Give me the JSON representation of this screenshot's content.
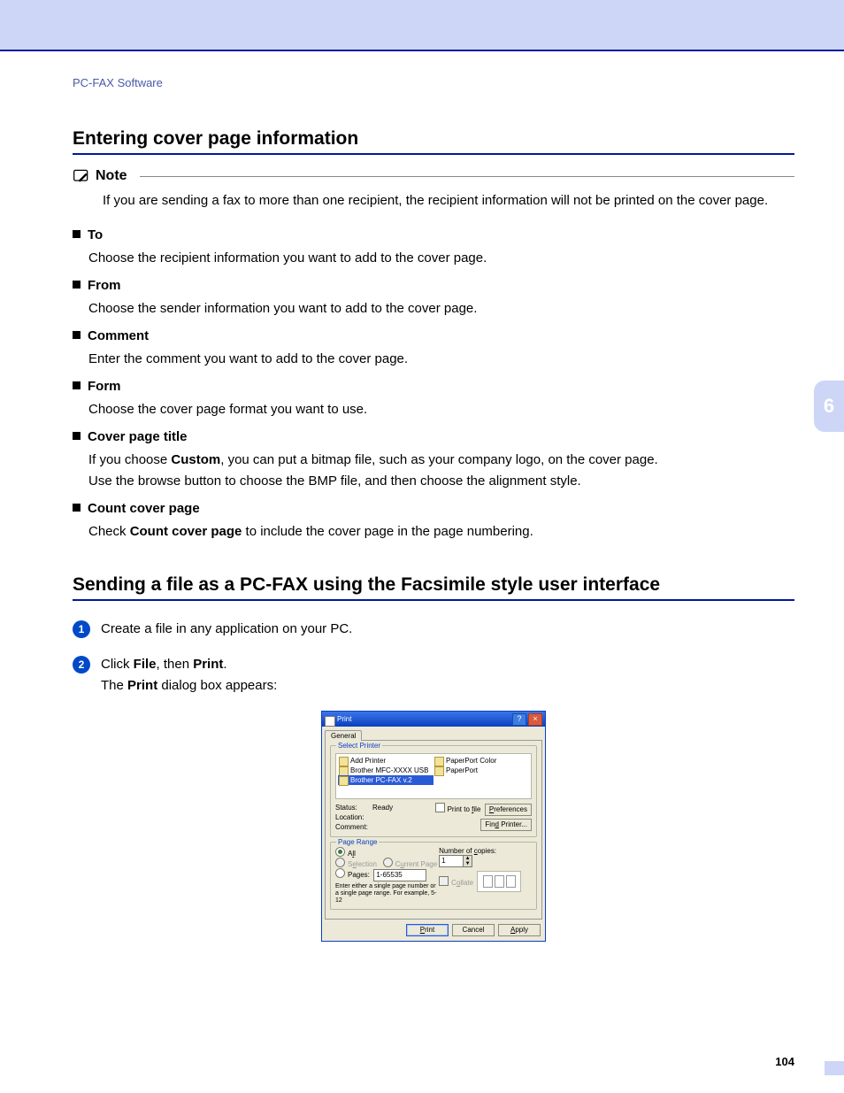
{
  "breadcrumb": "PC-FAX Software",
  "page_number": "104",
  "chapter_tab": "6",
  "section1_title": "Entering cover page information",
  "note": {
    "label": "Note",
    "text": "If you are sending a fax to more than one recipient, the recipient information will not be printed on the cover page."
  },
  "defs": {
    "to": {
      "head": "To",
      "text": "Choose the recipient information you want to add to the cover page."
    },
    "from": {
      "head": "From",
      "text": "Choose the sender information you want to add to the cover page."
    },
    "comment": {
      "head": "Comment",
      "text": "Enter the comment you want to add to the cover page."
    },
    "form": {
      "head": "Form",
      "text": "Choose the cover page format you want to use."
    },
    "cpt": {
      "head": "Cover page title",
      "t1a": "If you choose ",
      "t1b": "Custom",
      "t1c": ", you can put a bitmap file, such as your company logo, on the cover page.",
      "t2": "Use the browse button to choose the BMP file, and then choose the alignment style."
    },
    "ccp": {
      "head": "Count cover page",
      "t1a": "Check ",
      "t1b": "Count cover page",
      "t1c": " to include the cover page in the page numbering."
    }
  },
  "section2_title": "Sending a file as a PC-FAX using the Facsimile style user interface",
  "steps": {
    "s1": "Create a file in any application on your PC.",
    "s2a": "Click ",
    "s2b": "File",
    "s2c": ", then ",
    "s2d": "Print",
    "s2e": ".",
    "s2f": "The ",
    "s2g": "Print",
    "s2h": " dialog box appears:"
  },
  "dialog": {
    "title": "Print",
    "tab_general": "General",
    "grp_select": "Select Printer",
    "printers": {
      "add": "Add Printer",
      "p1": "Brother MFC-XXXX USB Printer",
      "p2": "Brother PC-FAX v.2",
      "pp_color": "PaperPort Color",
      "pp": "PaperPort"
    },
    "status_label": "Status:",
    "status_val": "Ready",
    "location_label": "Location:",
    "comment_label": "Comment:",
    "print_to_file": "Print to file",
    "preferences": "Preferences",
    "find_printer": "Find Printer...",
    "grp_range": "Page Range",
    "all": "All",
    "selection": "Selection",
    "current": "Current Page",
    "pages": "Pages:",
    "pages_val": "1-65535",
    "pages_hint": "Enter either a single page number or a single page range.  For example, 5-12",
    "copies_label": "Number of copies:",
    "copies_val": "1",
    "collate": "Collate",
    "print": "Print",
    "cancel": "Cancel",
    "apply": "Apply"
  }
}
